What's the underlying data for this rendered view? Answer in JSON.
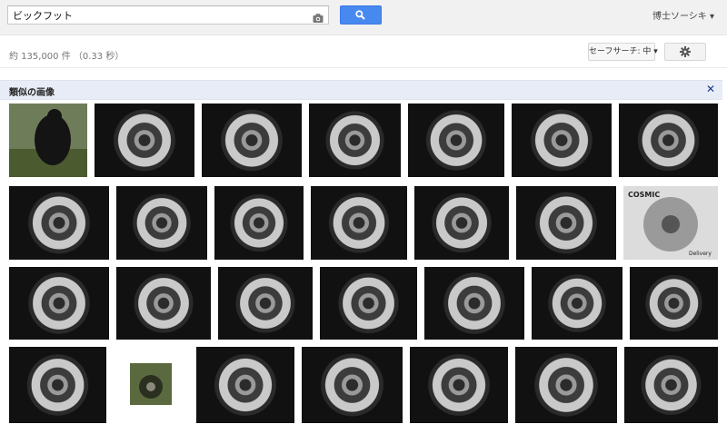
{
  "header": {
    "query": "ビックフット",
    "account_label": "博士ソーシキ ▾"
  },
  "toolbar": {
    "results_stats": "約 135,000 件 （0.33 秒）",
    "safesearch_label": "セーフサーチ: 中 ▾"
  },
  "similar": {
    "title": "類似の画像",
    "close_label": "✕"
  },
  "thumb_labels": {
    "row2_col6_top": "COSMIC",
    "row2_col6_bottom": "Delivery"
  },
  "colors": {
    "search_blue": "#4889f0",
    "bar_bg": "#e7ecf6",
    "header_bg": "#f1f1f1"
  },
  "icons": [
    "camera-icon",
    "search-icon",
    "gear-icon",
    "close-icon"
  ]
}
